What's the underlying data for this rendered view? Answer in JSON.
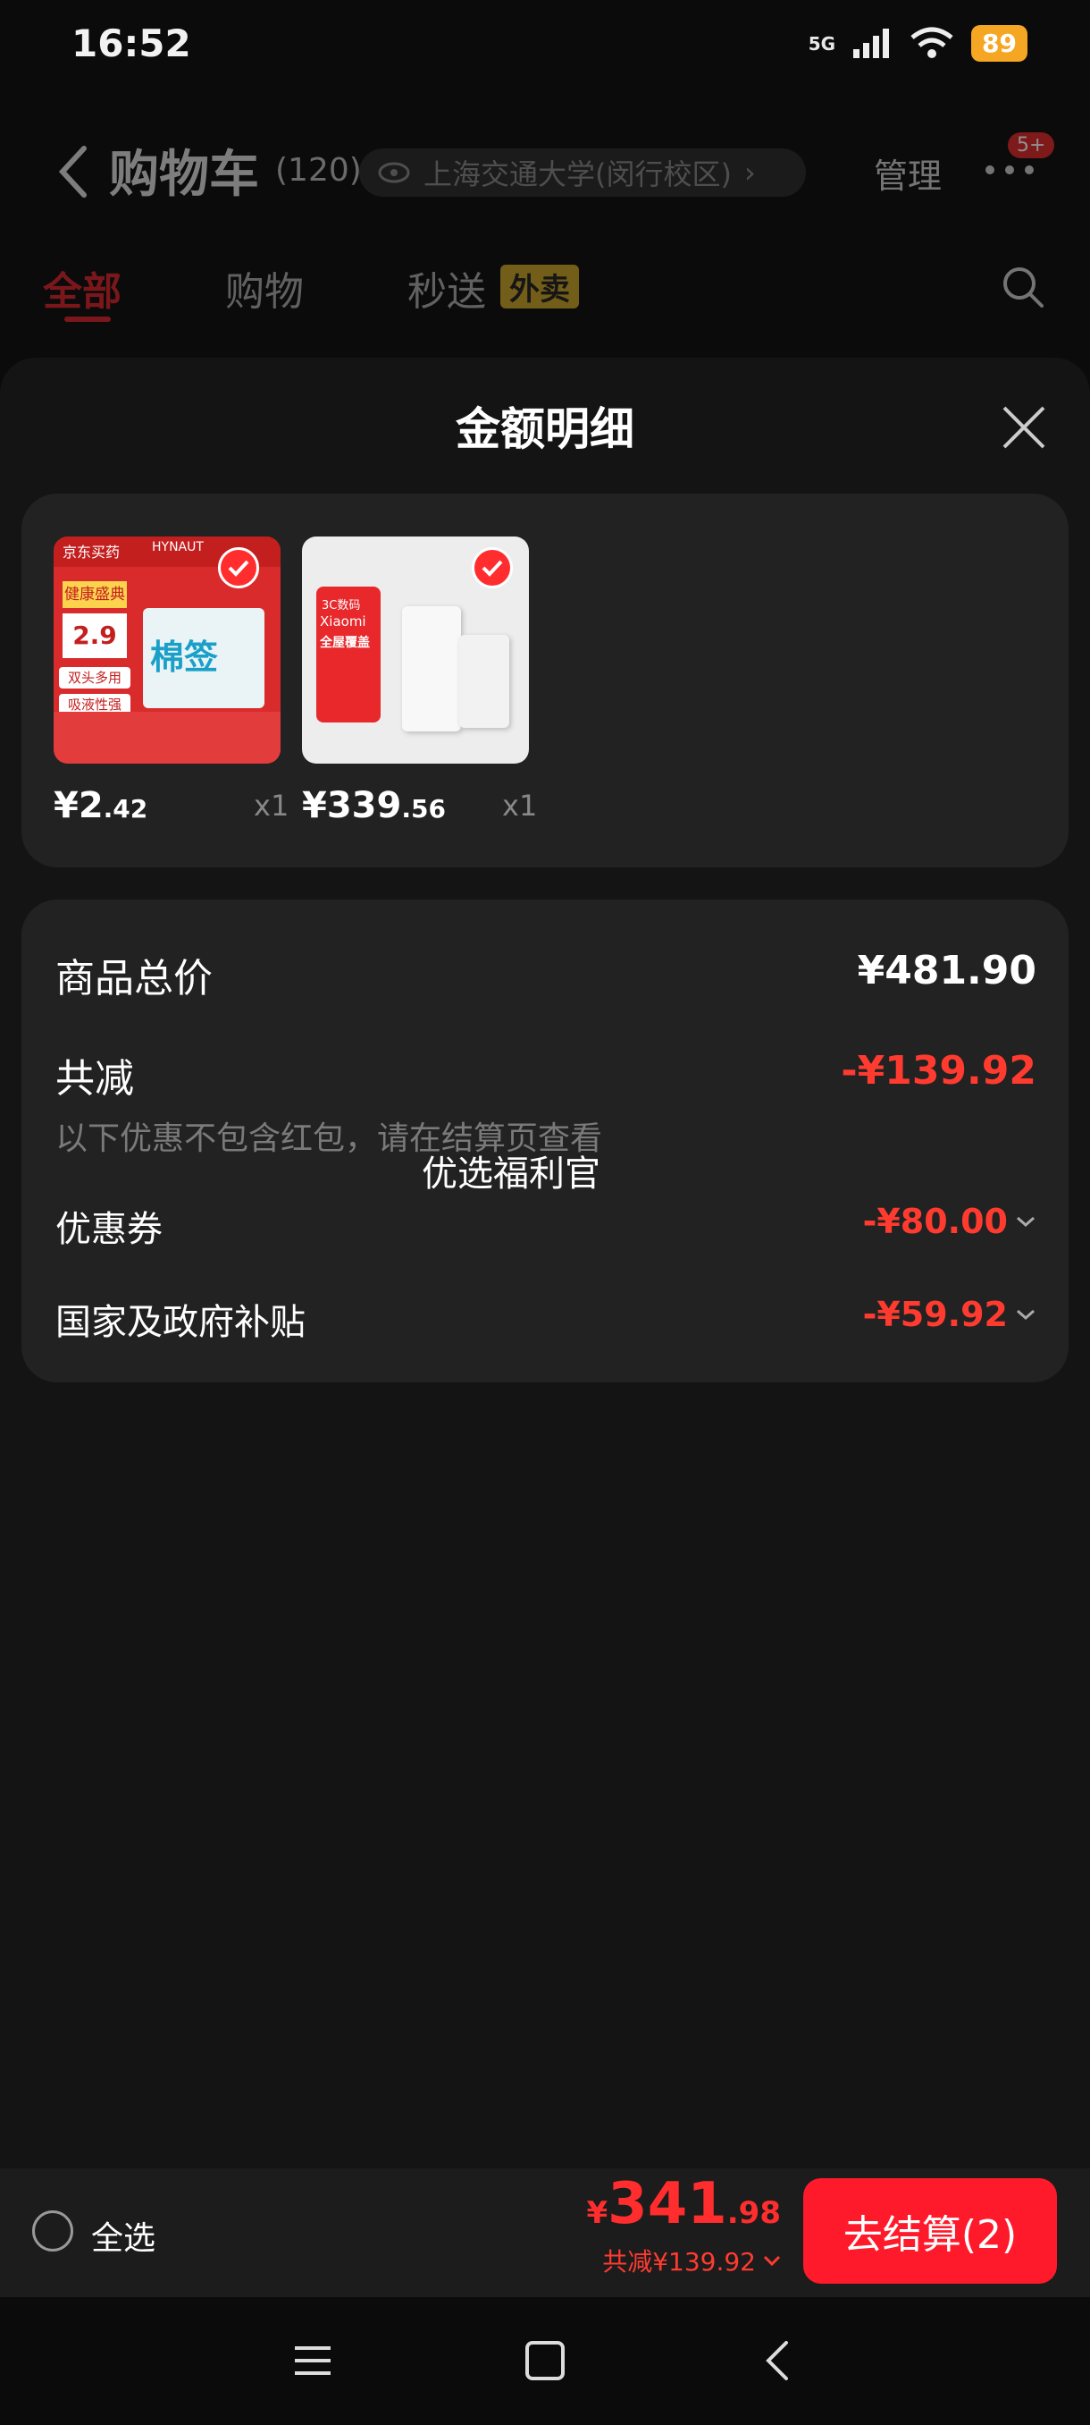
{
  "status": {
    "time": "16:52",
    "network": "5G",
    "battery": "89"
  },
  "header": {
    "title": "购物车",
    "count": "(120)",
    "location": "上海交通大学(闵行校区)",
    "manage": "管理",
    "badge": "5+"
  },
  "tabs": {
    "all": "全部",
    "shopping": "购物",
    "fast": "秒送",
    "takeout": "外卖"
  },
  "sheet": {
    "title": "金额明细",
    "products": [
      {
        "price_int": "¥2",
        "price_dec": ".42",
        "qty": "x1",
        "img_text": {
          "brand": "京东买药",
          "brand2": "HYNAUT",
          "tag1": "健康盛典",
          "price_tag": "2.9",
          "feat1": "双头多用",
          "feat2": "吸液性强",
          "name": "棉签"
        }
      },
      {
        "price_int": "¥339",
        "price_dec": ".56",
        "qty": "x1",
        "img_text": {
          "tag": "3C数码",
          "brand": "Xiaomi",
          "feat": "全屋覆盖"
        }
      }
    ],
    "summary": {
      "total_label": "商品总价",
      "total_value": "¥481.90",
      "reduce_label": "共减",
      "reduce_value": "-¥139.92",
      "note": "以下优惠不包含红包，请在结算页查看",
      "overlay_text": "优选福利官",
      "coupon_label": "优惠券",
      "coupon_value": "-¥80.00",
      "subsidy_label": "国家及政府补贴",
      "subsidy_value": "-¥59.92"
    }
  },
  "bottom": {
    "select_all": "全选",
    "total_yen": "¥",
    "total_int": "341",
    "total_dec": ".98",
    "discount": "共减¥139.92",
    "checkout": "去结算(2)"
  },
  "colors": {
    "accent": "#ff1a2b",
    "discount": "#ff3b30",
    "sheet": "#141414",
    "card": "#222222"
  }
}
